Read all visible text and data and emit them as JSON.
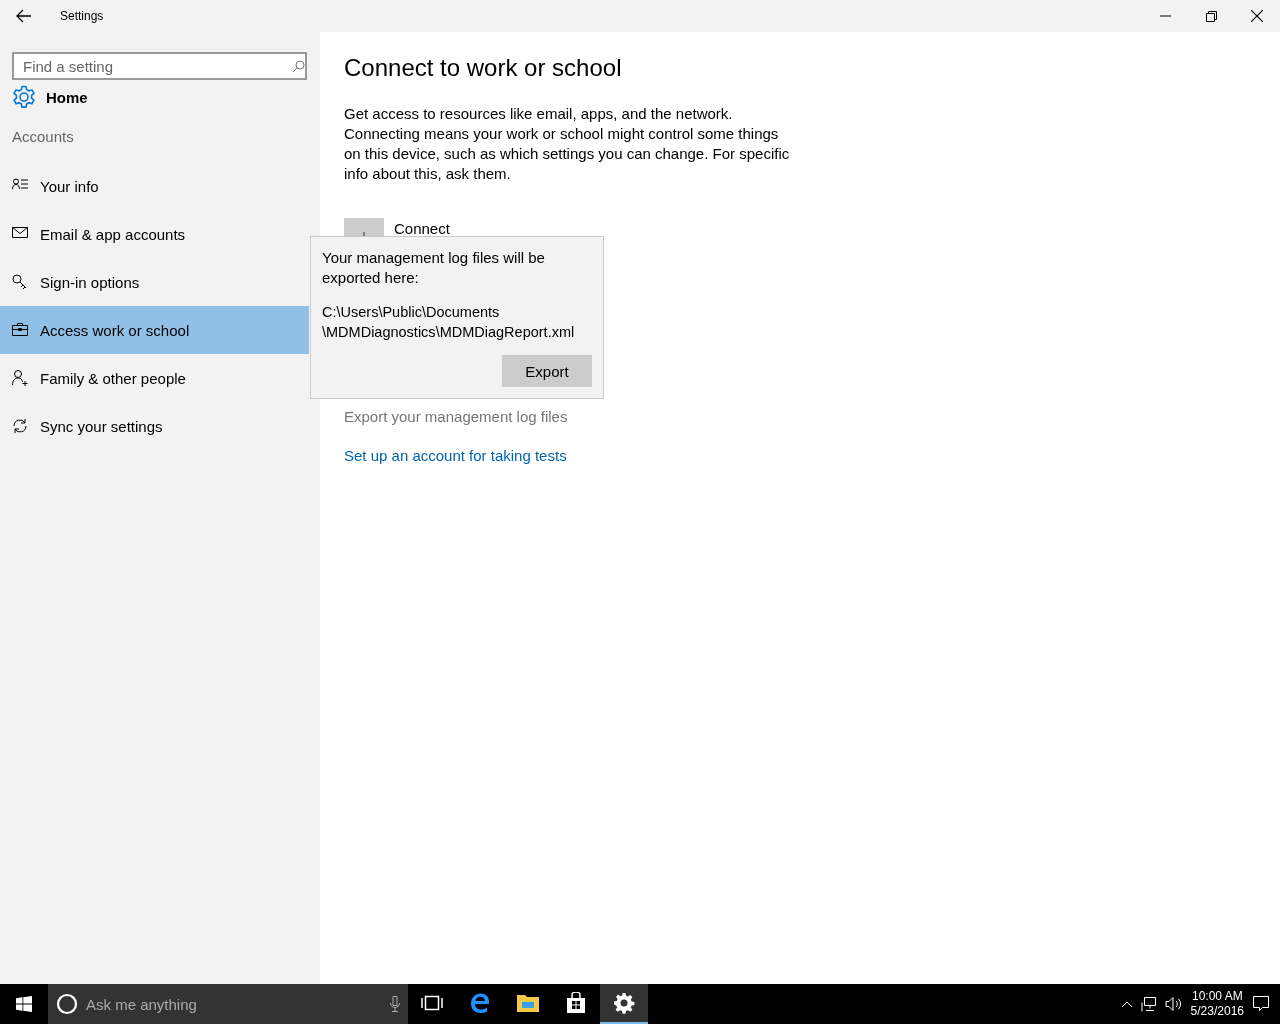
{
  "window": {
    "title": "Settings"
  },
  "sidebar": {
    "search": {
      "placeholder": "Find a setting"
    },
    "home": "Home",
    "section": "Accounts",
    "items": [
      {
        "label": "Your info",
        "selected": false
      },
      {
        "label": "Email & app accounts",
        "selected": false
      },
      {
        "label": "Sign-in options",
        "selected": false
      },
      {
        "label": "Access work or school",
        "selected": true
      },
      {
        "label": "Family & other people",
        "selected": false
      },
      {
        "label": "Sync your settings",
        "selected": false
      }
    ]
  },
  "main": {
    "title": "Connect to work or school",
    "description": "Get access to resources like email, apps, and the network. Connecting means your work or school might control some things on this device, such as which settings you can change. For specific info about this, ask them.",
    "connect_button": "Connect",
    "export_link": "Export your management log files",
    "test_link": "Set up an account for taking tests"
  },
  "flyout": {
    "message": "Your management log files will be exported here:",
    "path": "C:\\Users\\Public\\Documents\\MDMDiagnostics\\MDMDiagReport.xml",
    "button": "Export"
  },
  "taskbar": {
    "search": {
      "placeholder": "Ask me anything"
    },
    "apps": [
      {
        "selected": false
      },
      {
        "selected": false
      },
      {
        "selected": false
      },
      {
        "selected": false
      },
      {
        "selected": true
      }
    ],
    "time": "10:00 AM",
    "date": "5/23/2016"
  }
}
